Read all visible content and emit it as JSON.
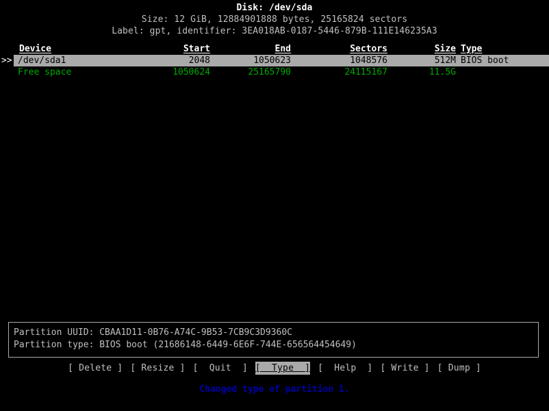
{
  "app": {
    "name": "cfdisk",
    "background": "#000000",
    "colors": {
      "text": "#c0c0c0",
      "bright": "#ffffff",
      "green": "#00aa00",
      "blue": "#0000aa",
      "highlight_bg": "#aaaaaa",
      "highlight_fg": "#000000",
      "border": "#aaaaaa"
    }
  },
  "header": {
    "title": "Disk: /dev/sda",
    "size_line": "Size: 12 GiB, 12884901888 bytes, 25165824 sectors",
    "label_line": "Label: gpt, identifier: 3EA018AB-0187-5446-879B-111E146235A3",
    "disk_name": "/dev/sda",
    "size_human": "12 GiB",
    "size_bytes": "12884901888",
    "sectors": "25165824",
    "label_type": "gpt",
    "identifier": "3EA018AB-0187-5446-879B-111E146235A3"
  },
  "table": {
    "columns": {
      "device": "Device",
      "start": "Start",
      "end": "End",
      "sectors": "Sectors",
      "size": "Size",
      "type": "Type"
    },
    "rows": [
      {
        "marker": ">>",
        "device": "/dev/sda1",
        "start": "2048",
        "end": "1050623",
        "sectors": "1048576",
        "size": "512M",
        "type": "BIOS boot",
        "selected": true,
        "free": false
      },
      {
        "marker": "",
        "device": "Free space",
        "start": "1050624",
        "end": "25165790",
        "sectors": "24115167",
        "size": "11.5G",
        "type": "",
        "selected": false,
        "free": true
      }
    ]
  },
  "info": {
    "uuid_line": "Partition UUID: CBAA1D11-0B76-A74C-9B53-7CB9C3D9360C",
    "type_line": "Partition type: BIOS boot (21686148-6449-6E6F-744E-656564454649)",
    "partition_uuid": "CBAA1D11-0B76-A74C-9B53-7CB9C3D9360C",
    "partition_type": "BIOS boot",
    "partition_type_guid": "21686148-6449-6E6F-744E-656564454649"
  },
  "buttons": [
    {
      "label": "Delete",
      "text": "[ Delete ]",
      "active": false
    },
    {
      "label": "Resize",
      "text": "[ Resize ]",
      "active": false
    },
    {
      "label": "Quit",
      "text": "[  Quit  ]",
      "active": false
    },
    {
      "label": "Type",
      "text": "[  Type  ]",
      "active": true
    },
    {
      "label": "Help",
      "text": "[  Help  ]",
      "active": false
    },
    {
      "label": "Write",
      "text": "[ Write ]",
      "active": false
    },
    {
      "label": "Dump",
      "text": "[ Dump ]",
      "active": false
    }
  ],
  "status": {
    "message": "Changed type of partition 1.",
    "color": "#0000aa"
  }
}
